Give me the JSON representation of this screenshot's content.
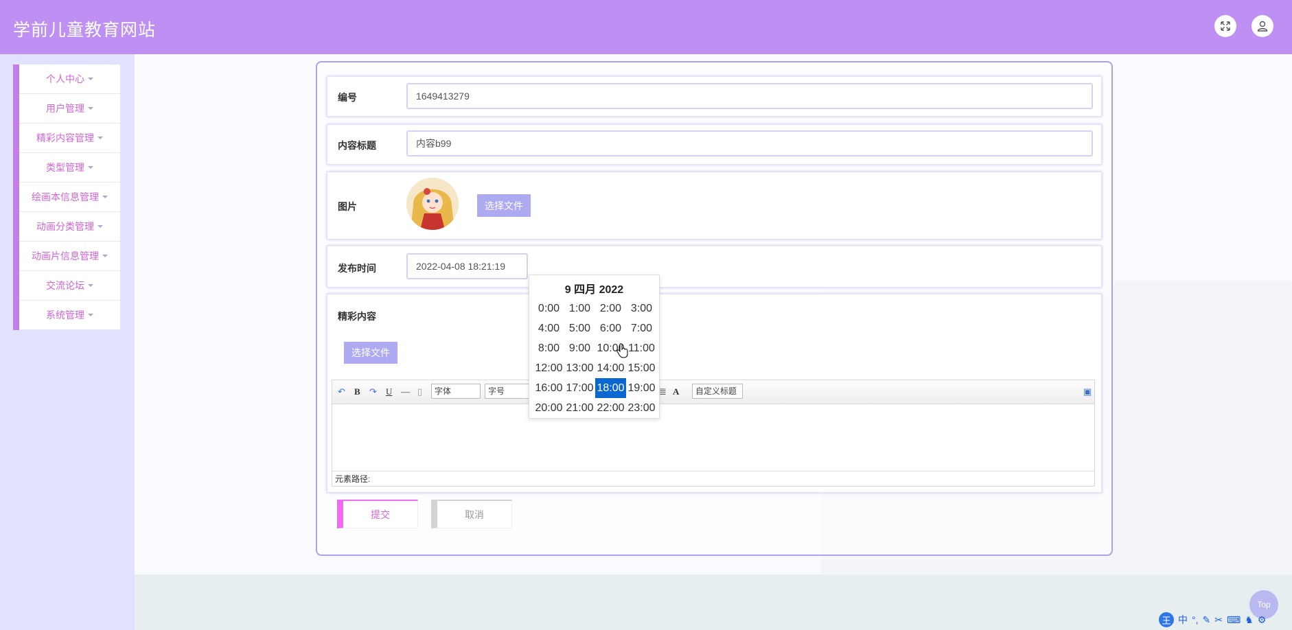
{
  "app": {
    "title": "学前儿童教育网站"
  },
  "header": {
    "fullscreen_icon": "expand-icon",
    "user_icon": "user-icon"
  },
  "sidebar": {
    "items": [
      {
        "label": "个人中心"
      },
      {
        "label": "用户管理"
      },
      {
        "label": "精彩内容管理"
      },
      {
        "label": "类型管理"
      },
      {
        "label": "绘画本信息管理"
      },
      {
        "label": "动画分类管理"
      },
      {
        "label": "动画片信息管理"
      },
      {
        "label": "交流论坛"
      },
      {
        "label": "系统管理"
      }
    ]
  },
  "form": {
    "id_label": "编号",
    "id_value": "1649413279",
    "title_label": "内容标题",
    "title_value": "内容b99",
    "image_label": "图片",
    "image_button": "选择文件",
    "time_label": "发布时间",
    "time_value": "2022-04-08 18:21:19",
    "content_label": "精彩内容",
    "content_button": "选择文件",
    "submit_label": "提交",
    "cancel_label": "取消"
  },
  "editor": {
    "font_family": "字体",
    "font_size": "字号",
    "custom_title": "自定义标题",
    "status": "元素路径:"
  },
  "datetime_picker": {
    "title": "9 四月 2022",
    "hours": [
      "0:00",
      "1:00",
      "2:00",
      "3:00",
      "4:00",
      "5:00",
      "6:00",
      "7:00",
      "8:00",
      "9:00",
      "10:00",
      "11:00",
      "12:00",
      "13:00",
      "14:00",
      "15:00",
      "16:00",
      "17:00",
      "18:00",
      "19:00",
      "20:00",
      "21:00",
      "22:00",
      "23:00"
    ],
    "selected": "18:00"
  },
  "top_button": {
    "label": "Top"
  },
  "ime": {
    "main": "王",
    "mode": "中"
  },
  "colors": {
    "header": "#bf90f4",
    "accent": "#d163d6",
    "selected": "#0b68d0"
  }
}
